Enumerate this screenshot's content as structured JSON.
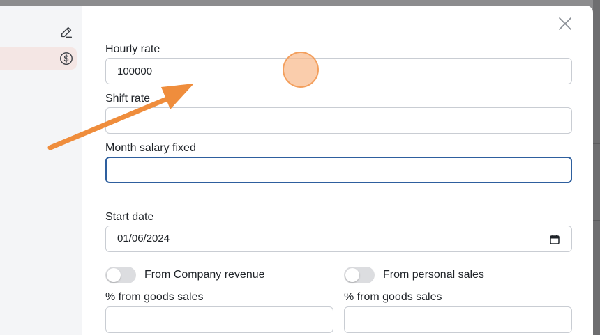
{
  "icons": {
    "edit": "pencil-icon",
    "salary": "dollar-circle-icon",
    "close": "close-icon",
    "calendar": "calendar-icon"
  },
  "form": {
    "hourly_rate": {
      "label": "Hourly rate",
      "value": "100000"
    },
    "shift_rate": {
      "label": "Shift rate",
      "value": ""
    },
    "month_salary": {
      "label": "Month salary fixed",
      "value": ""
    },
    "start_date": {
      "label": "Start date",
      "value": "01/06/2024"
    },
    "company_revenue": {
      "label": "From Company revenue",
      "on": false
    },
    "personal_sales": {
      "label": "From personal sales",
      "on": false
    },
    "goods_sales_left": {
      "label": "% from goods sales",
      "value": ""
    },
    "goods_sales_right": {
      "label": "% from goods sales",
      "value": ""
    }
  },
  "colors": {
    "accent_focus": "#2e5f9e",
    "annotation_arrow": "#ef8d3c",
    "sidebar_active": "#f4e6e4"
  }
}
